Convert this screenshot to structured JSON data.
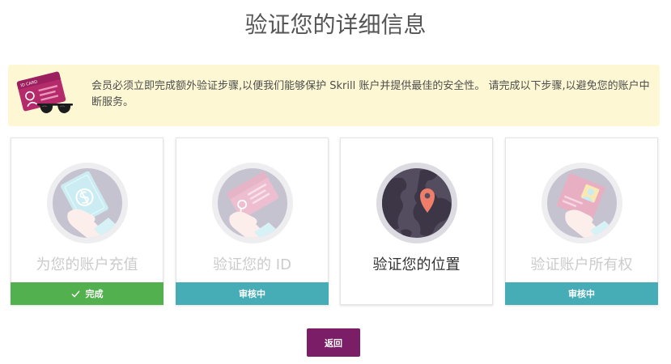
{
  "page": {
    "title": "验证您的详细信息"
  },
  "notice": {
    "icon": "id-card-sunglasses-icon",
    "card_caption": "ID CARD",
    "message": "会员必须立即完成额外验证步骤,以便我们能够保护 Skrill 账户并提供最佳的安全性。 请完成以下步骤,以避免您的账户中断服务。"
  },
  "steps": [
    {
      "label": "为您的账户充值",
      "icon": "money-in-hand-icon",
      "state": "complete",
      "status_label": "完成",
      "status_icon": "check-icon"
    },
    {
      "label": "验证您的 ID",
      "icon": "id-card-in-hand-icon",
      "state": "in-review",
      "status_label": "审核中"
    },
    {
      "label": "验证您的位置",
      "icon": "globe-location-pin-icon",
      "state": "current"
    },
    {
      "label": "验证账户所有权",
      "icon": "photo-id-in-hand-icon",
      "state": "in-review",
      "status_label": "审核中"
    }
  ],
  "actions": {
    "back_label": "返回"
  },
  "colors": {
    "brand": "#7b1d67",
    "notice_bg": "#fdf8d3",
    "complete": "#53b04f",
    "in_review": "#46adb7",
    "location_pin": "#ef7d6a"
  }
}
